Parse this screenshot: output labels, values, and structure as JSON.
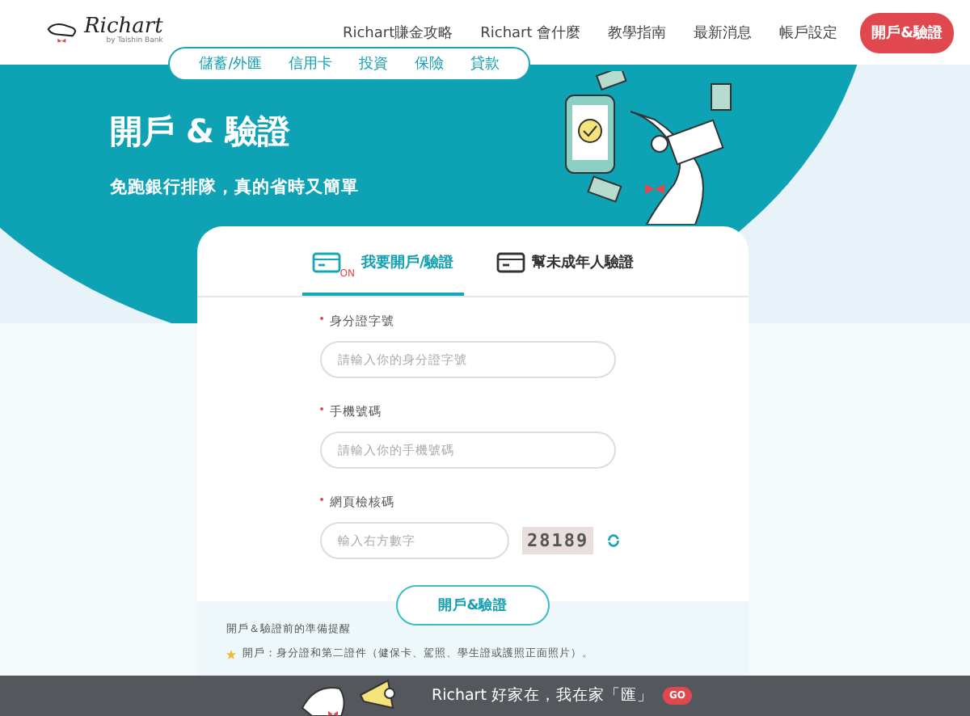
{
  "header": {
    "logo": "Richart",
    "logo_sub": "by Taishin Bank",
    "nav": [
      "Richart賺金攻略",
      "Richart 會什麼",
      "教學指南",
      "最新消息",
      "帳戶設定"
    ],
    "cta": "開戶&驗證"
  },
  "subnav": [
    "儲蓄/外匯",
    "信用卡",
    "投資",
    "保險",
    "貸款"
  ],
  "hero": {
    "title": "開戶 & 驗證",
    "subtitle": "免跑銀行排隊，真的省時又簡單"
  },
  "tabs": [
    {
      "label": "我要開戶/驗證",
      "selected": true,
      "badge": "ON"
    },
    {
      "label": "幫未成年人驗證",
      "selected": false
    }
  ],
  "fields": [
    {
      "label": "身分證字號",
      "required": true,
      "placeholder": "請輸入你的身分證字號"
    },
    {
      "label": "手機號碼",
      "required": true,
      "placeholder": "請輸入你的手機號碼"
    },
    {
      "label": "網頁檢核碼",
      "required": true,
      "placeholder": "輸入右方數字",
      "captcha": "28189"
    }
  ],
  "submit": "開戶&驗證",
  "notes": {
    "title": "開戶＆驗證前的準備提醒",
    "items": [
      "開戶：身分證和第二證件（健保卡、駕照、學生證或護照正面照片）。"
    ]
  },
  "banner": {
    "text": "Richart 好家在，我在家「匯」",
    "button": "GO"
  }
}
